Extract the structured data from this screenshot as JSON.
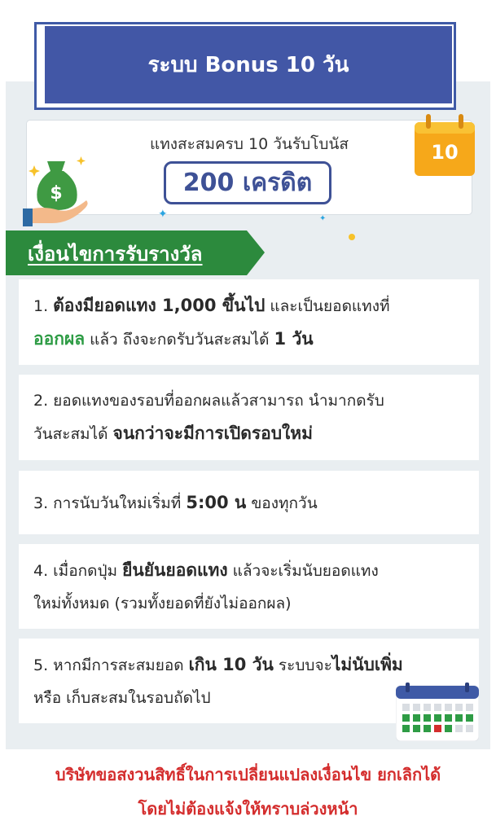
{
  "header": {
    "title": "ระบบ Bonus 10 วัน"
  },
  "bonus": {
    "subtitle": "แทงสะสมครบ 10 วันรับโบนัส",
    "amount": "200 เครดิต",
    "calendar_day": "10"
  },
  "section": {
    "heading": "เงื่อนไขการรับรางวัล"
  },
  "conditions": [
    {
      "lines": [
        [
          "1. ",
          "ต้องมียอดแทง 1,000 ขึ้นไป",
          " และเป็นยอดแทงที่"
        ],
        [
          "",
          "ออกผล",
          " แล้ว ถึงจะกดรับวันสะสมได้ ",
          "1 วัน"
        ]
      ]
    },
    {
      "l1a": "2. ",
      "l1b": "ยอดแทงของรอบที่ออกผลแล้วสามารถ นำมากดรับ",
      "l2a": "วันสะสมได้ ",
      "l2b": "จนกว่าจะมีการเปิดรอบใหม่"
    },
    {
      "a": "3. ",
      "b": "การนับวันใหม่เริ่มที่ ",
      "c": "5:00 น",
      "d": " ของทุกวัน"
    },
    {
      "a": "4. ",
      "b": "เมื่อกดปุ่ม ",
      "c": "ยืนยันยอดแทง",
      "d": " แล้วจะเริ่มนับยอดแทง",
      "e": "ใหม่ทั้งหมด (รวมทั้งยอดที่ยังไม่ออกผล)"
    },
    {
      "a": "5. ",
      "b": "หากมีการสะสมยอด ",
      "c": "เกิน 10 วัน",
      "d": " ระบบจะ",
      "e": "ไม่นับเพิ่ม",
      "f": "หรือ เก็บสะสมในรอบถัดไป"
    }
  ],
  "footer": {
    "line1": "บริษัทขอสงวนสิทธิ์ในการเปลี่ยนแปลงเงื่อนไข ยกเลิกได้",
    "line2": "โดยไม่ต้องแจ้งให้ทราบล่วงหน้า"
  },
  "colors": {
    "primary": "#4257a6",
    "green": "#2e9c45",
    "red": "#d42d2d"
  }
}
